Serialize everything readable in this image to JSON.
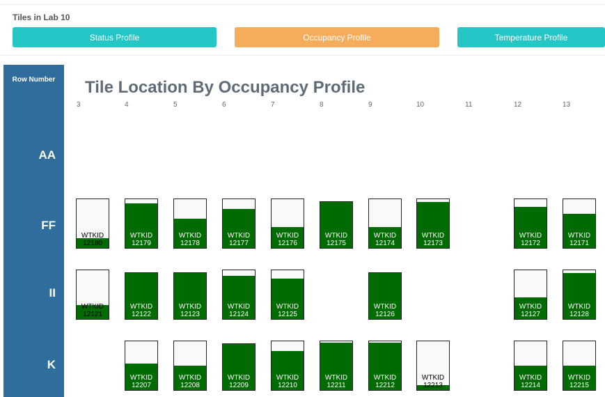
{
  "lab_title": "Tiles in Lab 10",
  "tabs": {
    "status": "Status Profile",
    "occupancy": "Occupancy Profile",
    "temperature": "Temperature Profile"
  },
  "row_header": "Row Number",
  "chart_title": "Tile Location By Occupancy Profile",
  "columns": [
    "3",
    "4",
    "5",
    "6",
    "7",
    "8",
    "9",
    "10",
    "11",
    "12",
    "13"
  ],
  "rows": [
    "AA",
    "FF",
    "II",
    "K"
  ],
  "colors": {
    "fill": "#006b00",
    "tab_teal": "#26c6c6",
    "tab_orange": "#f5ad5b",
    "sidebar": "#2e6d9c"
  },
  "tile_prefix": "WTKID",
  "tiles": [
    {
      "row": "FF",
      "col": "3",
      "id": "12180",
      "occupancy": 0.2
    },
    {
      "row": "FF",
      "col": "4",
      "id": "12179",
      "occupancy": 0.92
    },
    {
      "row": "FF",
      "col": "5",
      "id": "12178",
      "occupancy": 0.6
    },
    {
      "row": "FF",
      "col": "6",
      "id": "12177",
      "occupancy": 0.8
    },
    {
      "row": "FF",
      "col": "7",
      "id": "12176",
      "occupancy": 0.43
    },
    {
      "row": "FF",
      "col": "8",
      "id": "12175",
      "occupancy": 1.0
    },
    {
      "row": "FF",
      "col": "9",
      "id": "12174",
      "occupancy": 0.43
    },
    {
      "row": "FF",
      "col": "10",
      "id": "12173",
      "occupancy": 0.95
    },
    {
      "row": "FF",
      "col": "12",
      "id": "12172",
      "occupancy": 0.85
    },
    {
      "row": "FF",
      "col": "13",
      "id": "12171",
      "occupancy": 0.7
    },
    {
      "row": "II",
      "col": "3",
      "id": "12121",
      "occupancy": 0.28
    },
    {
      "row": "II",
      "col": "4",
      "id": "12122",
      "occupancy": 1.0
    },
    {
      "row": "II",
      "col": "5",
      "id": "12123",
      "occupancy": 1.0
    },
    {
      "row": "II",
      "col": "6",
      "id": "12124",
      "occupancy": 0.88
    },
    {
      "row": "II",
      "col": "7",
      "id": "12125",
      "occupancy": 0.83
    },
    {
      "row": "II",
      "col": "9",
      "id": "12126",
      "occupancy": 1.0
    },
    {
      "row": "II",
      "col": "12",
      "id": "12127",
      "occupancy": 0.45
    },
    {
      "row": "II",
      "col": "13",
      "id": "12128",
      "occupancy": 0.95
    },
    {
      "row": "K",
      "col": "4",
      "id": "12207",
      "occupancy": 0.55
    },
    {
      "row": "K",
      "col": "5",
      "id": "12208",
      "occupancy": 0.5
    },
    {
      "row": "K",
      "col": "6",
      "id": "12209",
      "occupancy": 1.0
    },
    {
      "row": "K",
      "col": "7",
      "id": "12210",
      "occupancy": 0.8
    },
    {
      "row": "K",
      "col": "8",
      "id": "12211",
      "occupancy": 0.97
    },
    {
      "row": "K",
      "col": "9",
      "id": "12212",
      "occupancy": 0.97
    },
    {
      "row": "K",
      "col": "10",
      "id": "12213",
      "occupancy": 0.1
    },
    {
      "row": "K",
      "col": "12",
      "id": "12214",
      "occupancy": 0.5
    },
    {
      "row": "K",
      "col": "13",
      "id": "12215",
      "occupancy": 0.5
    }
  ]
}
